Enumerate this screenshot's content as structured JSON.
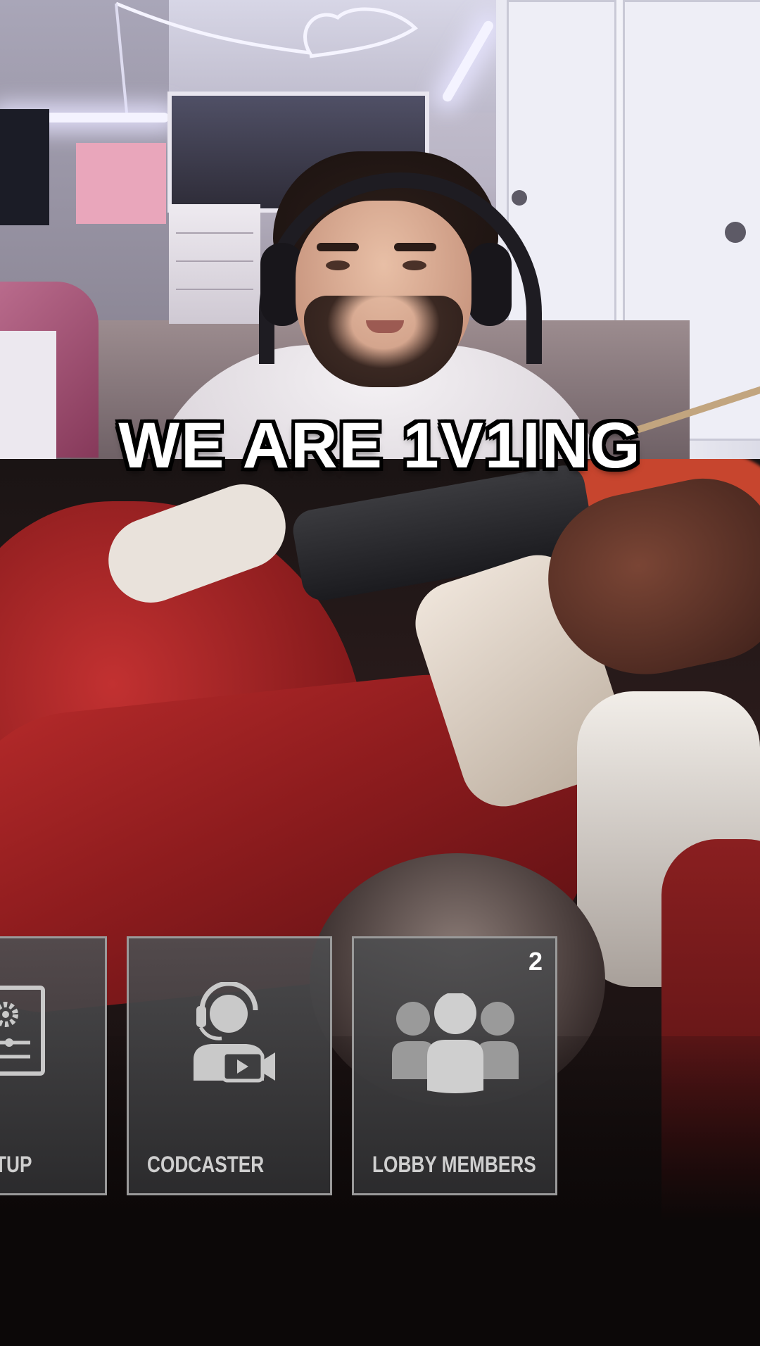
{
  "caption": {
    "text": "WE ARE 1V1ING"
  },
  "menu": {
    "tiles": [
      {
        "label": "TUP",
        "icon": "settings-panel-icon",
        "badge": ""
      },
      {
        "label": "CODCASTER",
        "icon": "codcaster-headset-camera-icon",
        "badge": ""
      },
      {
        "label": "LOBBY MEMBERS",
        "icon": "group-members-icon",
        "badge": "2"
      }
    ]
  },
  "colors": {
    "caption_text": "#ffffff",
    "caption_outline": "#000000",
    "tile_border": "#9a9a9a",
    "tile_label": "#cfcfcf",
    "santa_red": "#b52a2a"
  }
}
